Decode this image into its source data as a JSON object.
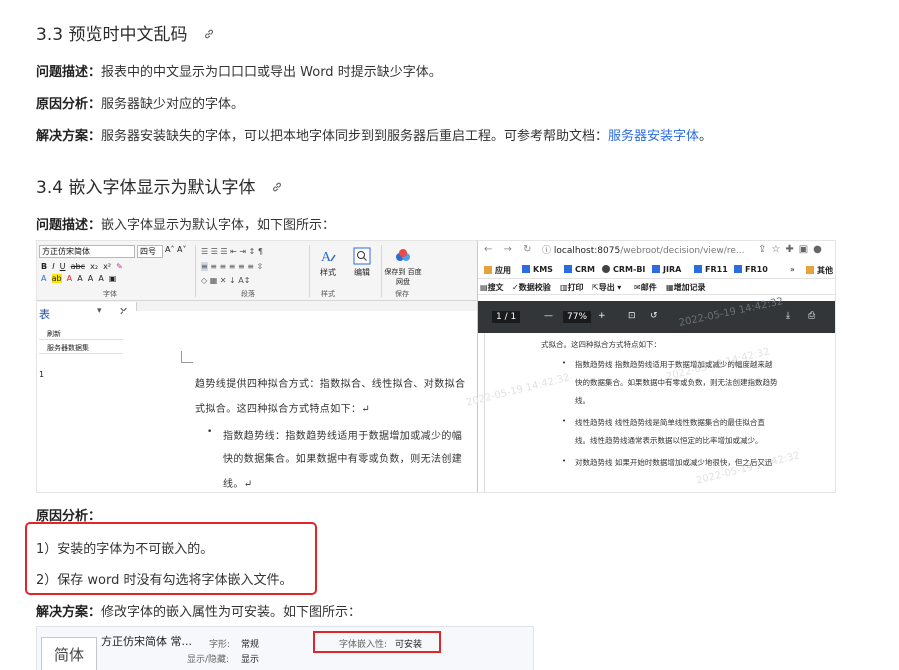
{
  "section33": {
    "title": "3.3 预览时中文乱码",
    "problem_label": "问题描述：",
    "problem_text": "报表中的中文显示为口口口或导出 Word 时提示缺少字体。",
    "cause_label": "原因分析：",
    "cause_text": "服务器缺少对应的字体。",
    "solution_label": "解决方案：",
    "solution_text": "服务器安装缺失的字体，可以把本地字体同步到到服务器后重启工程。可参考帮助文档：",
    "solution_link": "服务器安装字体",
    "solution_end": "。"
  },
  "section34": {
    "title": "3.4 嵌入字体显示为默认字体",
    "problem_label": "问题描述：",
    "problem_text": "嵌入字体显示为默认字体，如下图所示：",
    "cause_label": "原因分析：",
    "cause_item1": "1）安装的字体为不可嵌入的。",
    "cause_item2": "2）保存 word 时没有勾选将字体嵌入文件。",
    "solution_label": "解决方案：",
    "solution_text": "修改字体的嵌入属性为可安装。如下图所示："
  },
  "word_pane": {
    "font_name": "方正仿宋简体",
    "font_size": "四号",
    "group_font": "字体",
    "group_para": "段落",
    "group_style": "样式",
    "group_save": "保存",
    "btn_style": "样式",
    "btn_edit": "编辑",
    "btn_save": "保存到 百度网盘",
    "nav_title": "表",
    "nav_item1": "刷新",
    "nav_item2": "服务器数据集",
    "nav_num": "1",
    "doc_line1": "趋势线提供四种拟合方式：指数拟合、线性拟合、对数拟合",
    "doc_line2": "式拟合。这四种拟合方式特点如下：↵",
    "doc_line3": "指数趋势线：指数趋势线适用于数据增加或减少的幅",
    "doc_line4": "快的数据集合。如果数据中有零或负数，则无法创建",
    "doc_line5": "线。↵"
  },
  "pdf_pane": {
    "url_site": "localhost:8075",
    "url_path": "/webroot/decision/view/re...",
    "bookmarks": [
      "应用",
      "KMS",
      "CRM",
      "CRM-BI",
      "JIRA",
      "FR11",
      "FR10",
      "其他"
    ],
    "toolbar": [
      "搜文",
      "数据校验",
      "打印",
      "导出",
      "邮件",
      "增加记录"
    ],
    "page": "1 / 1",
    "zoom": "77%",
    "watermark": "2022-05-19 14:42:32",
    "line1": "式拟合。这四种拟合方式特点如下：",
    "line2": "指数趋势线   指数趋势线适用于数据增加或减少的幅度越来越",
    "line3": "快的数据集合。如果数据中有零或负数，则无法创建指数趋势",
    "line4": "线。",
    "line5": "线性趋势线   线性趋势线是简单线性数据集合的最佳拟合直",
    "line6": "线。线性趋势线通常表示数据以恒定的比率增加或减少。",
    "line7": "对数趋势线   如果开始时数据增加或减少地很快，但之后又迅"
  },
  "font_props": {
    "sample": "简体",
    "name": "方正仿宋简体 常...",
    "style_label": "字形:",
    "style_value": "常规",
    "visible_label": "显示/隐藏:",
    "visible_value": "显示",
    "embed_label": "字体嵌入性:",
    "embed_value": "可安装"
  },
  "colors": {
    "link": "#2b6de1",
    "highlight_border": "#e0262b",
    "pdf_toolbar": "#323639"
  }
}
